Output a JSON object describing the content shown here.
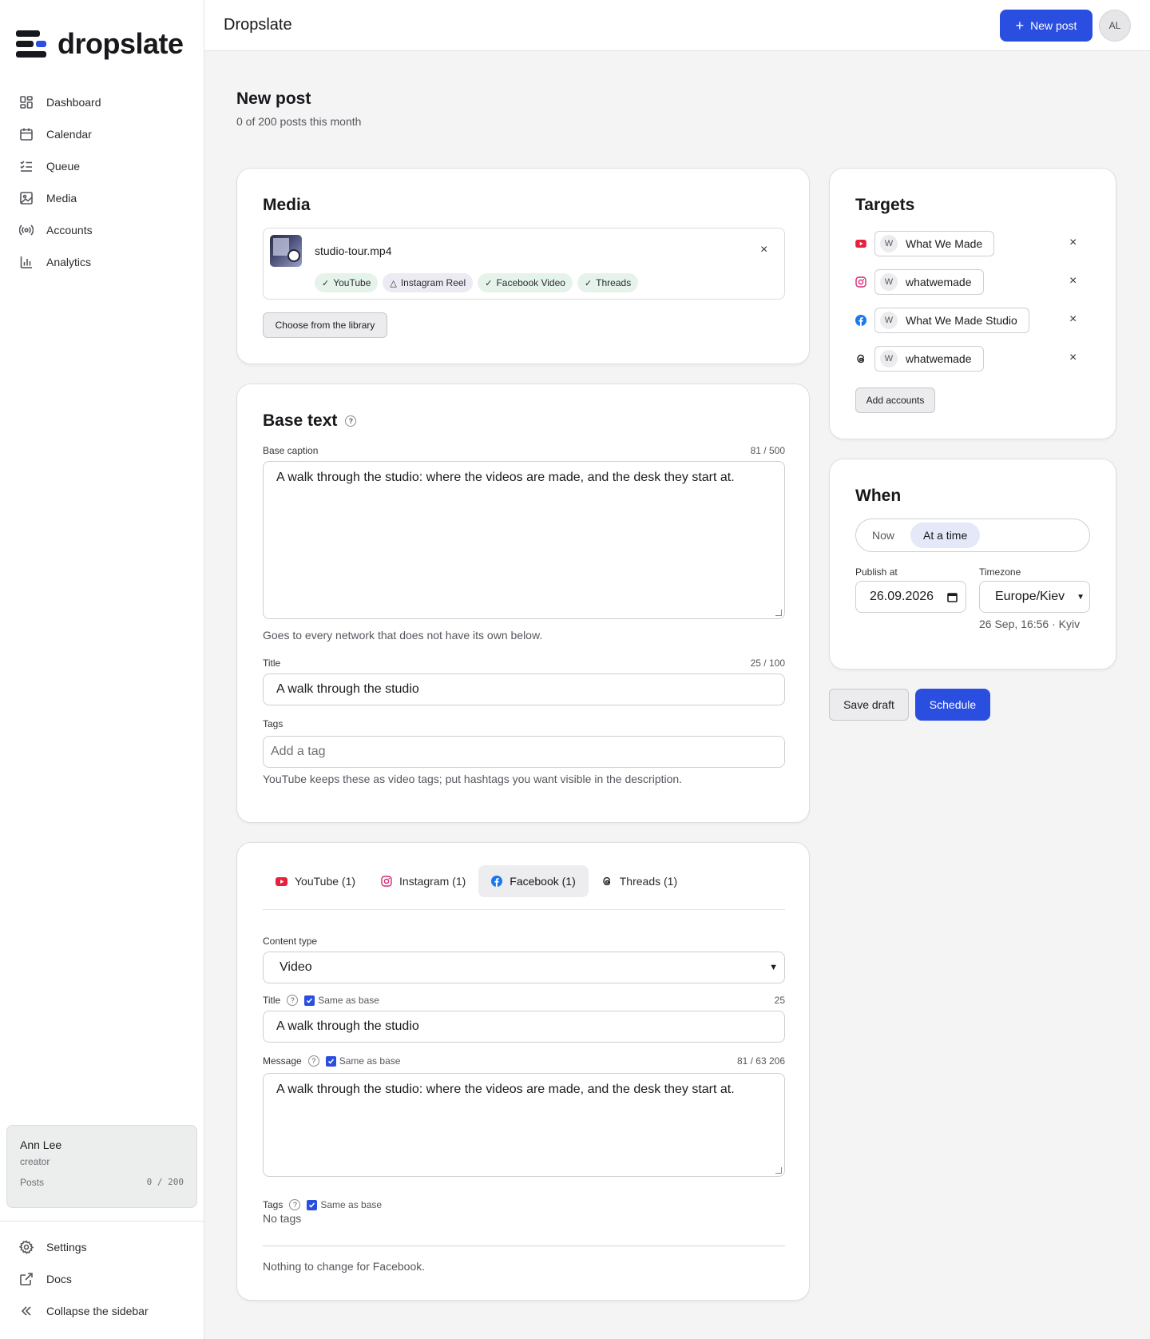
{
  "brand": {
    "name": "dropslate"
  },
  "nav": [
    {
      "label": "Dashboard",
      "icon": "dashboard-icon"
    },
    {
      "label": "Calendar",
      "icon": "calendar-icon"
    },
    {
      "label": "Queue",
      "icon": "queue-icon"
    },
    {
      "label": "Media",
      "icon": "media-icon"
    },
    {
      "label": "Accounts",
      "icon": "accounts-icon"
    },
    {
      "label": "Analytics",
      "icon": "analytics-icon"
    }
  ],
  "user": {
    "name": "Ann Lee",
    "role": "creator",
    "posts_label": "Posts",
    "posts_value": "0 / 200"
  },
  "sidebar_bottom": [
    {
      "label": "Settings",
      "icon": "gear-icon"
    },
    {
      "label": "Docs",
      "icon": "external-link-icon"
    },
    {
      "label": "Collapse the sidebar",
      "icon": "chevrons-left-icon"
    }
  ],
  "header": {
    "title": "Dropslate",
    "new_post": "New post",
    "avatar": "AL"
  },
  "page": {
    "title": "New post",
    "subtitle": "0 of 200 posts this month"
  },
  "media": {
    "title": "Media",
    "file_name": "studio-tour.mp4",
    "chips": [
      {
        "label": "YouTube",
        "status": "ok"
      },
      {
        "label": "Instagram Reel",
        "status": "warn"
      },
      {
        "label": "Facebook Video",
        "status": "ok"
      },
      {
        "label": "Threads",
        "status": "ok"
      }
    ],
    "library_button": "Choose from the library",
    "remove": "×"
  },
  "base": {
    "title": "Base text",
    "help": "?",
    "caption_label": "Base caption",
    "caption_counter": "81 / 500",
    "caption_value": "A walk through the studio: where the videos are made, and the desk they start at.",
    "caption_hint": "Goes to every network that does not have its own below.",
    "title_label": "Title",
    "title_counter": "25 / 100",
    "title_value": "A walk through the studio",
    "tags_label": "Tags",
    "tags_placeholder": "Add a tag",
    "tags_hint": "YouTube keeps these as video tags; put hashtags you want visible in the description."
  },
  "network": {
    "tabs": [
      {
        "label": "YouTube (1)",
        "icon": "youtube-icon"
      },
      {
        "label": "Instagram (1)",
        "icon": "instagram-icon"
      },
      {
        "label": "Facebook (1)",
        "icon": "facebook-icon"
      },
      {
        "label": "Threads (1)",
        "icon": "threads-icon"
      }
    ],
    "active_tab": 2,
    "content_type_label": "Content type",
    "content_type_value": "Video",
    "title_label": "Title",
    "title_same": "Same as base",
    "title_counter": "25",
    "title_value": "A walk through the studio",
    "message_label": "Message",
    "message_same": "Same as base",
    "message_counter": "81 / 63 206",
    "message_value": "A walk through the studio: where the videos are made, and the desk they start at.",
    "tags_label": "Tags",
    "tags_same": "Same as base",
    "tags_value": "No tags",
    "footer": "Nothing to change for Facebook."
  },
  "targets": {
    "title": "Targets",
    "accounts": [
      {
        "network": "youtube",
        "badge": "W",
        "name": "What We Made"
      },
      {
        "network": "instagram",
        "badge": "W",
        "name": "whatwemade"
      },
      {
        "network": "facebook",
        "badge": "W",
        "name": "What We Made Studio"
      },
      {
        "network": "threads",
        "badge": "W",
        "name": "whatwemade"
      }
    ],
    "add_button": "Add accounts"
  },
  "when": {
    "title": "When",
    "options": [
      "Now",
      "At a time"
    ],
    "selected": "At a time",
    "publish_label": "Publish at",
    "publish_value": "26.09.2026",
    "timezone_label": "Timezone",
    "timezone_value": "Europe/Kiev",
    "local_time": "26 Sep, 16:56 · Kyiv"
  },
  "actions": {
    "save_draft": "Save draft",
    "schedule": "Schedule"
  },
  "colors": {
    "primary": "#2a4ee0",
    "youtube": "#e8203d",
    "facebook": "#1877f2",
    "instagram": "#d62976"
  }
}
